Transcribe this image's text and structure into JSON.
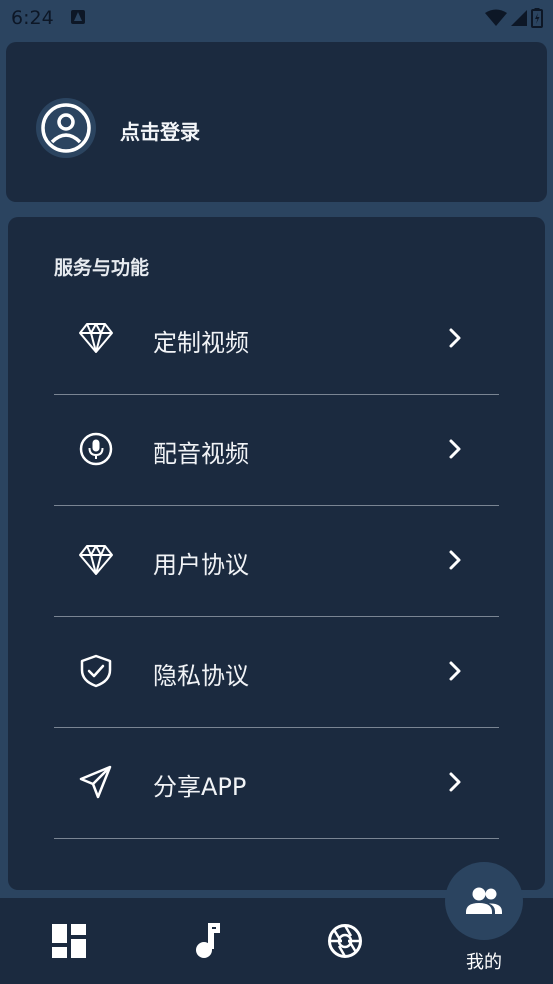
{
  "status_bar": {
    "time": "6:24"
  },
  "login": {
    "label": "点击登录"
  },
  "services": {
    "title": "服务与功能",
    "items": [
      {
        "label": "定制视频",
        "icon": "diamond-icon"
      },
      {
        "label": "配音视频",
        "icon": "microphone-icon"
      },
      {
        "label": "用户协议",
        "icon": "diamond-icon"
      },
      {
        "label": "隐私协议",
        "icon": "shield-check-icon"
      },
      {
        "label": "分享APP",
        "icon": "send-icon"
      }
    ]
  },
  "bottom_nav": {
    "items": [
      {
        "icon": "dashboard-icon"
      },
      {
        "icon": "music-note-icon"
      },
      {
        "icon": "aperture-icon"
      },
      {
        "icon": "people-icon",
        "label": "我的",
        "active": true
      }
    ]
  },
  "colors": {
    "background": "#2b4460",
    "card": "#1b2a3f",
    "text": "#f1f3f6"
  }
}
